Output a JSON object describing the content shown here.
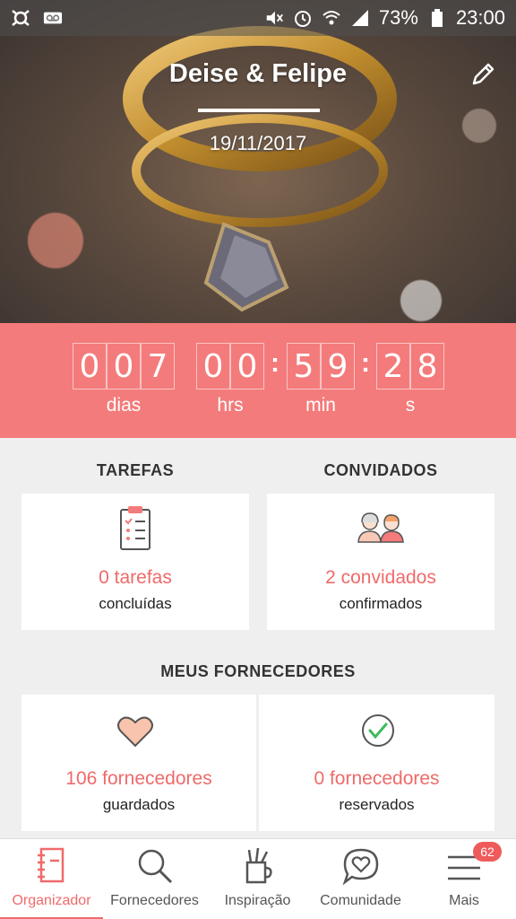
{
  "status_bar": {
    "battery": "73%",
    "time": "23:00"
  },
  "hero": {
    "couple": "Deise & Felipe",
    "date": "19/11/2017"
  },
  "countdown": {
    "days": [
      "0",
      "0",
      "7"
    ],
    "hours": [
      "0",
      "0"
    ],
    "minutes": [
      "5",
      "9"
    ],
    "seconds": [
      "2",
      "8"
    ],
    "separator": ":",
    "labels": {
      "days": "dias",
      "hours": "hrs",
      "minutes": "min",
      "seconds": "s"
    }
  },
  "tasks": {
    "title": "TAREFAS",
    "value": "0 tarefas",
    "sub": "concluídas"
  },
  "guests": {
    "title": "CONVIDADOS",
    "value": "2 convidados",
    "sub": "confirmados"
  },
  "vendors": {
    "title": "MEUS FORNECEDORES",
    "saved": {
      "value": "106 fornecedores",
      "sub": "guardados"
    },
    "booked": {
      "value": "0 fornecedores",
      "sub": "reservados"
    }
  },
  "bottom_nav": {
    "items": [
      {
        "label": "Organizador",
        "icon": "notebook-icon",
        "active": true
      },
      {
        "label": "Fornecedores",
        "icon": "search-icon",
        "active": false
      },
      {
        "label": "Inspiração",
        "icon": "brush-cup-icon",
        "active": false
      },
      {
        "label": "Comunidade",
        "icon": "chat-heart-icon",
        "active": false
      },
      {
        "label": "Mais",
        "icon": "menu-icon",
        "active": false
      }
    ],
    "badge": "62"
  },
  "colors": {
    "accent": "#f47b7b",
    "accent_text": "#ef6a6a"
  }
}
